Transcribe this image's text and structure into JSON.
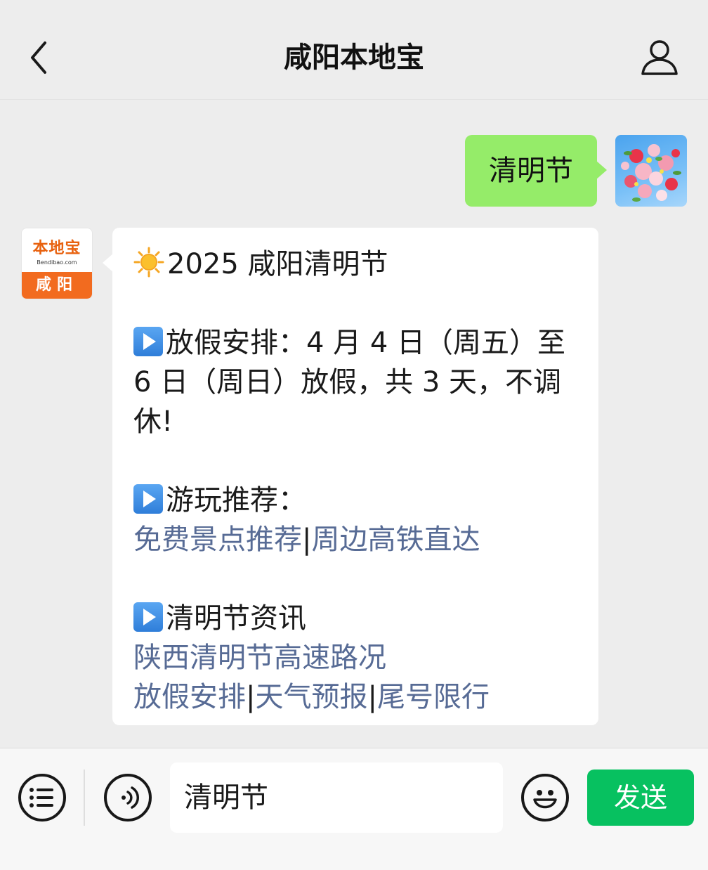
{
  "header": {
    "title": "咸阳本地宝"
  },
  "conversation": {
    "outgoing": {
      "text": "清明节"
    },
    "bot": {
      "avatar_logo": "本地宝",
      "avatar_sub": "Bendibao.com",
      "avatar_city": "咸阳",
      "heading": "2025 咸阳清明节",
      "holiday_label": "放假安排：4 月 4 日（周五）至",
      "holiday_line2": "6 日（周日）放假，共 3 天，不调",
      "holiday_line3": "休!",
      "travel_label": "游玩推荐：",
      "travel_links": [
        "免费景点推荐",
        "周边高铁直达"
      ],
      "news_label": "清明节资讯",
      "news_link_1": "陕西清明节高速路况",
      "news_links_2": [
        "放假安排",
        "天气预报",
        "尾号限行"
      ],
      "separator": "|"
    }
  },
  "input_bar": {
    "value": "清明节",
    "send_label": "发送"
  },
  "colors": {
    "outgoing_bubble": "#95ec69",
    "link": "#576b95",
    "send_button": "#07c160",
    "brand_orange": "#f26b1f"
  }
}
